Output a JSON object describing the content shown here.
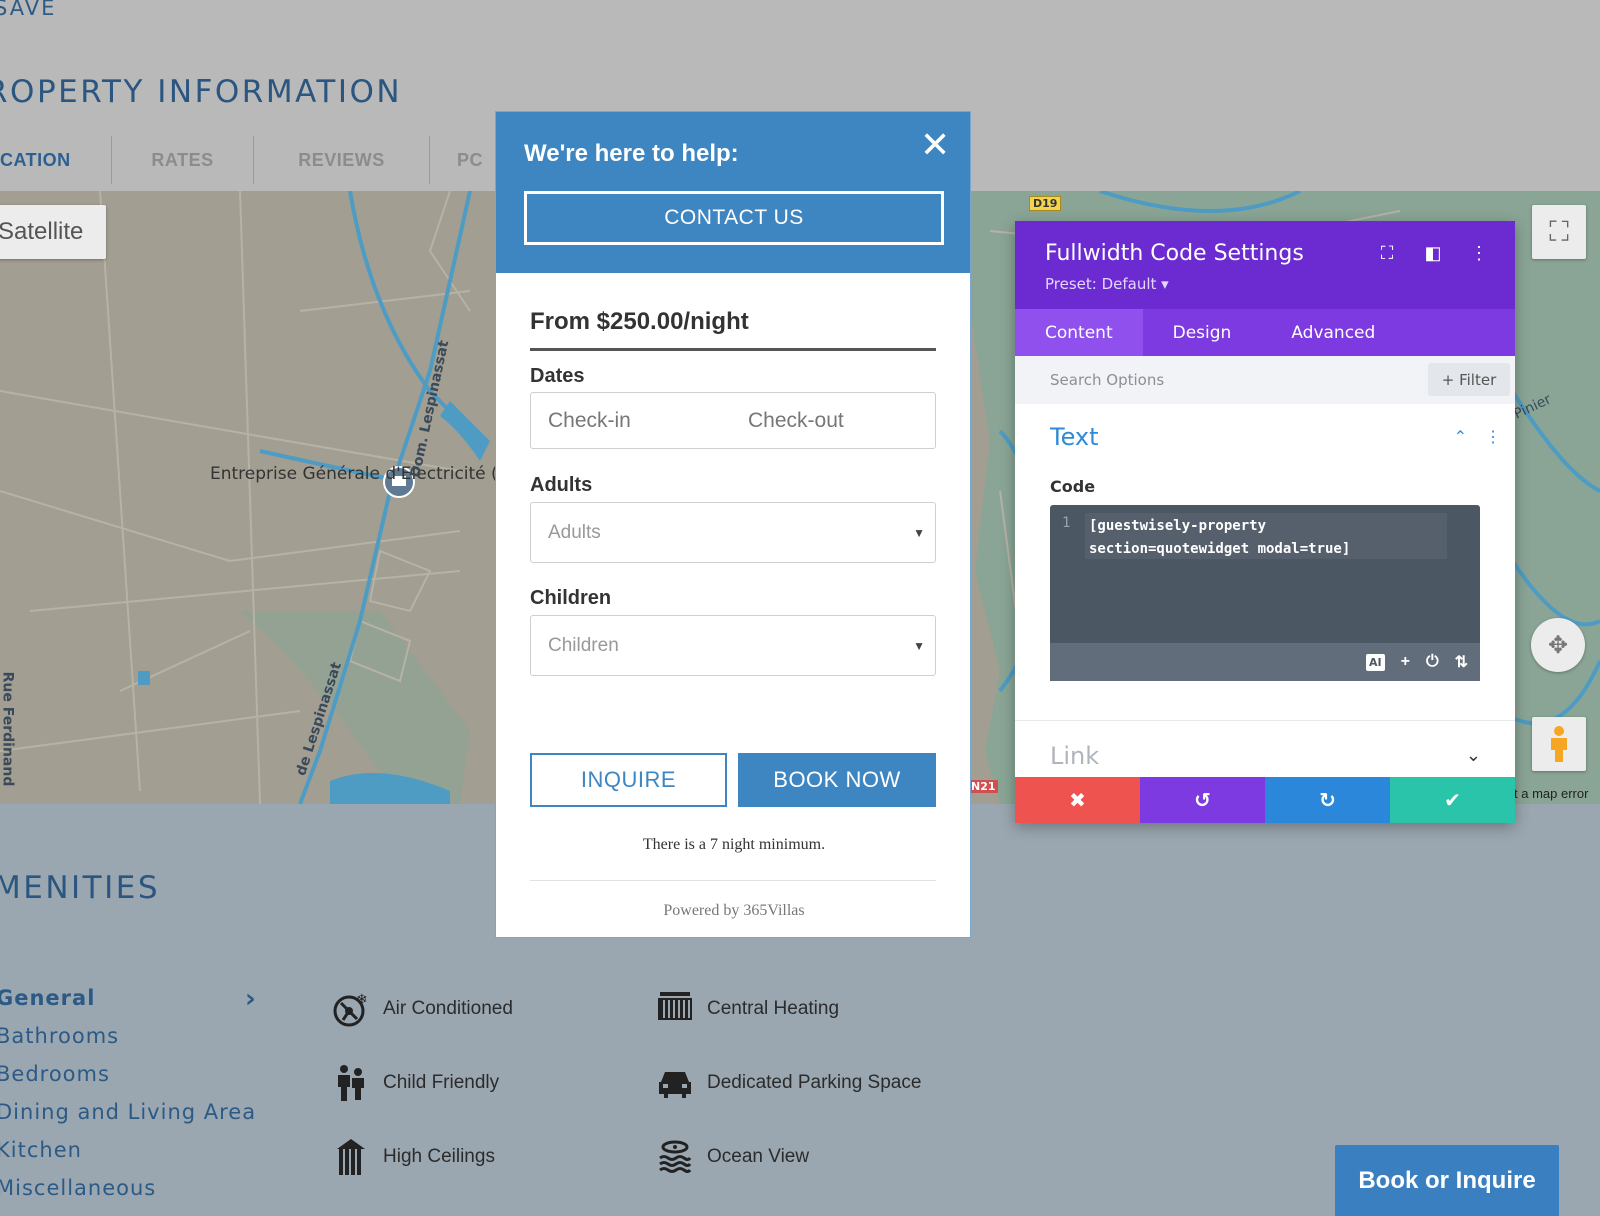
{
  "page": {
    "save_label": "SAVE",
    "property_title": "ROPERTY INFORMATION",
    "tabs": [
      "CATION",
      "RATES",
      "REVIEWS",
      "PC"
    ],
    "map": {
      "satellite_label": "Satellite",
      "poi_name": "Entreprise Générale d'Electricité (EGE)",
      "road_1": "Dom. Lespinassat",
      "road_2": "de Lespinassat",
      "road_3": "Rue Ferdinand",
      "road_4": "Pinier",
      "shield_d19": "D19",
      "shield_n21": "N21",
      "error_text": "t a map error",
      "fullscreen_icon": "fullscreen-icon",
      "pan_icon": "pan-control-icon",
      "pegman_icon": "pegman-icon"
    },
    "amenities_title": "MENITIES",
    "categories": [
      "General",
      "Bathrooms",
      "Bedrooms",
      "Dining and Living Area",
      "Kitchen",
      "Miscellaneous"
    ],
    "amenities": [
      {
        "label": "Air Conditioned",
        "icon": "air-conditioner-icon"
      },
      {
        "label": "Central Heating",
        "icon": "radiator-icon"
      },
      {
        "label": "Child Friendly",
        "icon": "children-icon"
      },
      {
        "label": "Dedicated Parking Space",
        "icon": "car-icon"
      },
      {
        "label": "High Ceilings",
        "icon": "columns-icon"
      },
      {
        "label": "Ocean View",
        "icon": "ocean-icon"
      }
    ],
    "book_inquire_label": "Book or Inquire"
  },
  "modal": {
    "heading": "We're here to help:",
    "contact_label": "CONTACT US",
    "price": "From $250.00/night",
    "dates_label": "Dates",
    "checkin_placeholder": "Check-in",
    "checkout_placeholder": "Check-out",
    "adults_label": "Adults",
    "adults_placeholder": "Adults",
    "children_label": "Children",
    "children_placeholder": "Children",
    "inquire_label": "INQUIRE",
    "book_now_label": "BOOK NOW",
    "minimum_note": "There is a 7 night minimum.",
    "powered_by": "Powered by 365Villas"
  },
  "panel": {
    "title": "Fullwidth Code Settings",
    "preset": "Preset: Default ▾",
    "tabs": [
      "Content",
      "Design",
      "Advanced"
    ],
    "active_tab": "Content",
    "search_placeholder": "Search Options",
    "filter_label": "+ Filter",
    "section_text": "Text",
    "code_label": "Code",
    "line_number": "1",
    "code_value": "[guestwisely-property\nsection=quotewidget modal=true]",
    "editor_ai_label": "AI",
    "section_link": "Link",
    "colors": {
      "header": "#6b2bd0",
      "tabs": "#7d3ae0",
      "cancel": "#ef5350",
      "undo": "#7d3ae0",
      "redo": "#2b87da",
      "save": "#29c4a9"
    }
  }
}
